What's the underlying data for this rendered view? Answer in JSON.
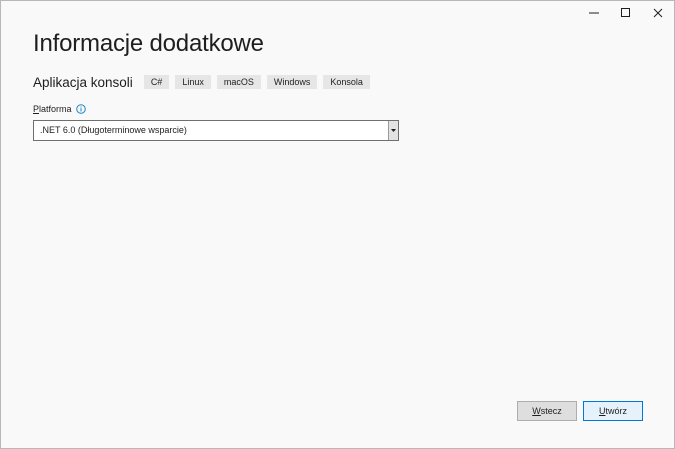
{
  "window": {
    "controls": [
      "minimize-icon",
      "maximize-icon",
      "close-icon"
    ]
  },
  "page": {
    "title": "Informacje dodatkowe",
    "subtitle": "Aplikacja konsoli",
    "tags": [
      "C#",
      "Linux",
      "macOS",
      "Windows",
      "Konsola"
    ]
  },
  "framework": {
    "label_mnemonic": "P",
    "label_rest": "latforma",
    "info_icon": "info-icon",
    "selected": ".NET 6.0 (Długoterminowe wsparcie)"
  },
  "footer": {
    "back_mnemonic": "W",
    "back_rest": "stecz",
    "create_mnemonic": "U",
    "create_rest": "twórz"
  },
  "colors": {
    "background": "#f9f9f9",
    "accent": "#0078d7",
    "info": "#1e88c7"
  }
}
